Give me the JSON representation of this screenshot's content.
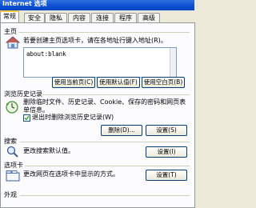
{
  "window": {
    "title": "Internet 选项"
  },
  "tabs": [
    {
      "label": "常规",
      "active": true
    },
    {
      "label": "安全",
      "active": false
    },
    {
      "label": "隐私",
      "active": false
    },
    {
      "label": "内容",
      "active": false
    },
    {
      "label": "连接",
      "active": false
    },
    {
      "label": "程序",
      "active": false
    },
    {
      "label": "高级",
      "active": false
    }
  ],
  "homepage": {
    "title": "主页",
    "description": "若要创建主页选项卡，请在各地址行键入地址(R)。",
    "url": "about:blank",
    "buttons": {
      "use_current": "使用当前页(C)",
      "use_default": "使用默认值(F)",
      "use_blank": "使用空白页(B)"
    }
  },
  "history": {
    "title": "浏览历史记录",
    "description": "删除临时文件、历史记录、Cookie、保存的密码和网页表单信息。",
    "checkbox_label": "退出时删除浏览历史记录(W)",
    "checkbox_checked": true,
    "buttons": {
      "delete": "删除(D)...",
      "settings": "设置(S)"
    }
  },
  "search": {
    "title": "搜索",
    "description": "更改搜索默认值。",
    "buttons": {
      "settings": "设置(I)"
    }
  },
  "tabs_section": {
    "title": "选项卡",
    "description": "更改网页在选项卡中显示的方式。",
    "buttons": {
      "settings": "设置(T)"
    }
  },
  "appearance": {
    "title": "外观"
  }
}
